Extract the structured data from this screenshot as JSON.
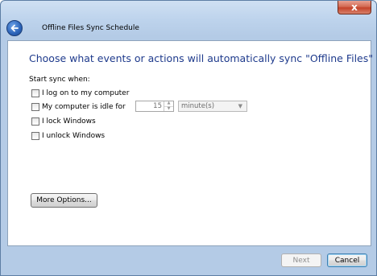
{
  "window": {
    "title": "Offline Files Sync Schedule",
    "close_glyph": "x"
  },
  "icons": {
    "back": "back-arrow-icon",
    "close": "close-icon",
    "dropdown": "chevron-down-icon"
  },
  "colors": {
    "heading": "#1e3a8c",
    "frame": "#b4cbe6",
    "close_button": "#c4432a"
  },
  "main": {
    "heading": "Choose what events or actions will automatically sync \"Offline Files\"",
    "start_sync_label": "Start sync when:",
    "options": [
      {
        "label": "I log on to my computer",
        "checked": false
      },
      {
        "label": "My computer is idle for",
        "checked": false
      },
      {
        "label": "I lock Windows",
        "checked": false
      },
      {
        "label": "I unlock Windows",
        "checked": false
      }
    ],
    "idle": {
      "value": "15",
      "unit": "minute(s)"
    },
    "more_options_label": "More Options..."
  },
  "footer": {
    "next_label": "Next",
    "cancel_label": "Cancel"
  }
}
